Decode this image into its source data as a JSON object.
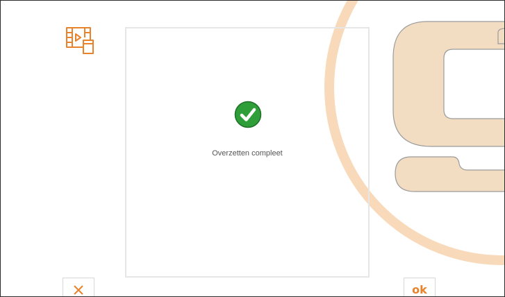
{
  "watermark": {
    "logo_icon": "g-logo-watermark-icon"
  },
  "header": {
    "media_icon": "video-transfer-icon"
  },
  "dialog": {
    "status_icon": "check-circle-icon",
    "message": "Overzetten compleet"
  },
  "actions": {
    "cancel_icon": "close-icon",
    "ok_label": "ok"
  },
  "colors": {
    "accent": "#e8822b",
    "watermark_ring": "#f8d9b9",
    "watermark_glyph_fill": "#f2dcc2",
    "watermark_glyph_outline": "#9b9b9b",
    "success": "#2e9e38",
    "panel_border": "#e6e6e6"
  }
}
